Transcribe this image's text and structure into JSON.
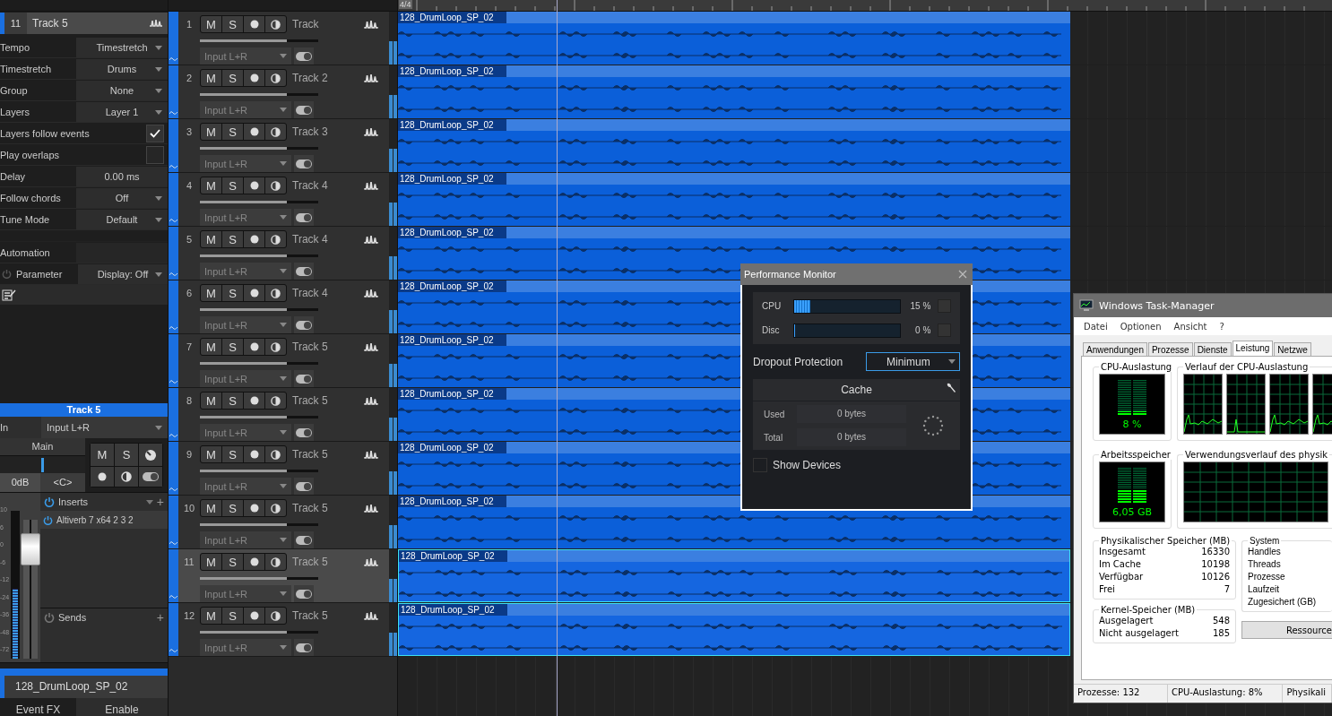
{
  "inspector": {
    "number": "11",
    "name": "Track 5",
    "properties": [
      {
        "kind": "dropdown",
        "label": "Tempo",
        "value": "Timestretch"
      },
      {
        "kind": "dropdown",
        "label": "Timestretch",
        "value": "Drums"
      },
      {
        "kind": "dropdown",
        "label": "Group",
        "value": "None"
      },
      {
        "kind": "dropdown",
        "label": "Layers",
        "value": "Layer 1"
      },
      {
        "kind": "checkbox",
        "label": "Layers follow events",
        "checked": true
      },
      {
        "kind": "checkbox",
        "label": "Play overlaps",
        "checked": false
      },
      {
        "kind": "value",
        "label": "Delay",
        "value": "0.00 ms"
      },
      {
        "kind": "dropdown",
        "label": "Follow chords",
        "value": "Off"
      },
      {
        "kind": "dropdown",
        "label": "Tune Mode",
        "value": "Default"
      }
    ],
    "automation_label": "Automation",
    "parameter_label": "Parameter",
    "display": "Display: Off"
  },
  "channel": {
    "name": "Track 5",
    "input_label": "In",
    "input": "Input L+R",
    "output": "Main",
    "pan_slider": {
      "level": 0.5
    },
    "volume": "0dB",
    "pan": "<C>",
    "buttons": [
      "M",
      "S"
    ],
    "scale": [
      "10",
      "6",
      "0",
      "-6",
      "-12",
      "-24",
      "-36",
      "-48",
      "-72"
    ],
    "fader": {
      "level": 0.78
    },
    "meter": {
      "level": 0.47
    },
    "inserts_label": "Inserts",
    "inserts_add": "+",
    "inserts": [
      "Altiverb 7 x64 2 3 2"
    ],
    "sends_label": "Sends",
    "sends_add": "+"
  },
  "event": {
    "name": "128_DrumLoop_SP_02",
    "fx_label": "Event FX",
    "fx_value": "Enable"
  },
  "ruler": {
    "signature": "4/4"
  },
  "tracks": [
    {
      "number": "1",
      "buttons": [
        "M",
        "S"
      ],
      "name": "Track",
      "selected": false,
      "event_selected": false,
      "input": "Input L+R",
      "event": "128_DrumLoop_SP_02"
    },
    {
      "number": "2",
      "buttons": [
        "M",
        "S"
      ],
      "name": "Track 2",
      "selected": false,
      "event_selected": false,
      "input": "Input L+R",
      "event": "128_DrumLoop_SP_02"
    },
    {
      "number": "3",
      "buttons": [
        "M",
        "S"
      ],
      "name": "Track 3",
      "selected": false,
      "event_selected": false,
      "input": "Input L+R",
      "event": "128_DrumLoop_SP_02"
    },
    {
      "number": "4",
      "buttons": [
        "M",
        "S"
      ],
      "name": "Track 4",
      "selected": false,
      "event_selected": false,
      "input": "Input L+R",
      "event": "128_DrumLoop_SP_02"
    },
    {
      "number": "5",
      "buttons": [
        "M",
        "S"
      ],
      "name": "Track 4",
      "selected": false,
      "event_selected": false,
      "input": "Input L+R",
      "event": "128_DrumLoop_SP_02"
    },
    {
      "number": "6",
      "buttons": [
        "M",
        "S"
      ],
      "name": "Track 4",
      "selected": false,
      "event_selected": false,
      "input": "Input L+R",
      "event": "128_DrumLoop_SP_02"
    },
    {
      "number": "7",
      "buttons": [
        "M",
        "S"
      ],
      "name": "Track 5",
      "selected": false,
      "event_selected": false,
      "input": "Input L+R",
      "event": "128_DrumLoop_SP_02"
    },
    {
      "number": "8",
      "buttons": [
        "M",
        "S"
      ],
      "name": "Track 5",
      "selected": false,
      "event_selected": false,
      "input": "Input L+R",
      "event": "128_DrumLoop_SP_02"
    },
    {
      "number": "9",
      "buttons": [
        "M",
        "S"
      ],
      "name": "Track 5",
      "selected": false,
      "event_selected": false,
      "input": "Input L+R",
      "event": "128_DrumLoop_SP_02"
    },
    {
      "number": "10",
      "buttons": [
        "M",
        "S"
      ],
      "name": "Track 5",
      "selected": false,
      "event_selected": false,
      "input": "Input L+R",
      "event": "128_DrumLoop_SP_02"
    },
    {
      "number": "11",
      "buttons": [
        "M",
        "S"
      ],
      "name": "Track 5",
      "selected": true,
      "event_selected": true,
      "input": "Input L+R",
      "event": "128_DrumLoop_SP_02"
    },
    {
      "number": "12",
      "buttons": [
        "M",
        "S"
      ],
      "name": "Track 5",
      "selected": false,
      "event_selected": true,
      "input": "Input L+R",
      "event": "128_DrumLoop_SP_02"
    }
  ],
  "performance_monitor": {
    "title": "Performance Monitor",
    "meters": [
      {
        "label": "CPU",
        "level": 0.15,
        "reading": "15 %"
      },
      {
        "label": "Disc",
        "level": 0,
        "reading": "0 %"
      }
    ],
    "dropout_label": "Dropout Protection",
    "dropout_value": "Minimum",
    "cache_title": "Cache",
    "cache_rows": [
      {
        "label": "Used",
        "value": "0 bytes"
      },
      {
        "label": "Total",
        "value": "0 bytes"
      }
    ],
    "show_devices": {
      "label": "Show Devices",
      "checked": false
    }
  },
  "task_manager": {
    "title": "Windows Task-Manager",
    "menu": [
      "Datei",
      "Optionen",
      "Ansicht",
      "?"
    ],
    "tabs": [
      {
        "label": "Anwendungen",
        "selected": false
      },
      {
        "label": "Prozesse",
        "selected": false
      },
      {
        "label": "Dienste",
        "selected": false
      },
      {
        "label": "Leistung",
        "selected": true
      },
      {
        "label": "Netzwe",
        "selected": false
      }
    ],
    "cpu_title": "CPU-Auslastung",
    "cpu_reading": "8 %",
    "cpu_history_title": "Verlauf der CPU-Auslastung",
    "memory_title": "Arbeitsspeicher",
    "memory_reading": "6,05 GB",
    "memory_history_title": "Verwendungsverlauf des physik",
    "physical": {
      "title": "Physikalischer Speicher (MB)",
      "rows": [
        {
          "label": "Insgesamt",
          "value": "16330"
        },
        {
          "label": "Im Cache",
          "value": "10198"
        },
        {
          "label": "Verfügbar",
          "value": "10126"
        },
        {
          "label": "Frei",
          "value": "7"
        }
      ]
    },
    "kernel": {
      "title": "Kernel-Speicher (MB)",
      "rows": [
        {
          "label": "Ausgelagert",
          "value": "548"
        },
        {
          "label": "Nicht ausgelagert",
          "value": "185"
        }
      ]
    },
    "system": {
      "title": "System",
      "rows": [
        "Handles",
        "Threads",
        "Prozesse",
        "Laufzeit",
        "Zugesichert (GB)"
      ]
    },
    "button": "Ressource",
    "status": [
      "Prozesse: 132",
      "CPU-Auslastung: 8%",
      "Physikali"
    ]
  }
}
